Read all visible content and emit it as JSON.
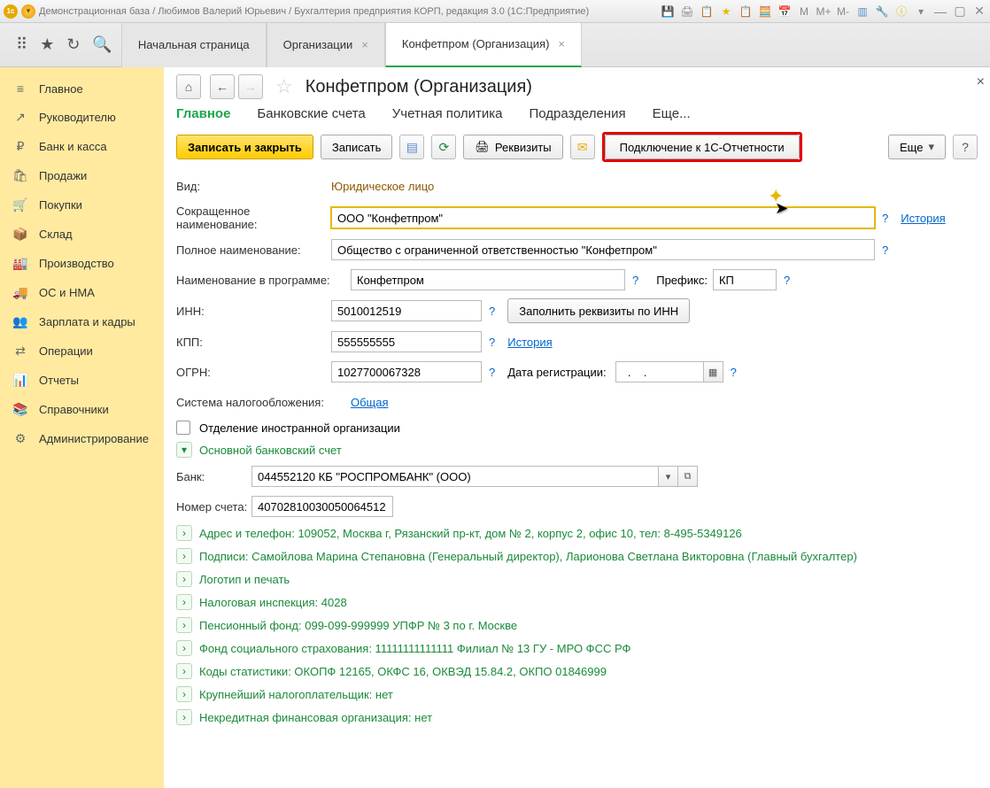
{
  "title": "Демонстрационная база / Любимов Валерий Юрьевич / Бухгалтерия предприятия КОРП, редакция 3.0 (1С:Предприятие)",
  "tabs": {
    "t0": "Начальная страница",
    "t1": "Организации",
    "t2": "Конфетпром (Организация)"
  },
  "sidebar": {
    "items": [
      {
        "icon": "≡",
        "label": "Главное"
      },
      {
        "icon": "↗",
        "label": "Руководителю"
      },
      {
        "icon": "₽",
        "label": "Банк и касса"
      },
      {
        "icon": "🛍",
        "label": "Продажи"
      },
      {
        "icon": "🛒",
        "label": "Покупки"
      },
      {
        "icon": "📦",
        "label": "Склад"
      },
      {
        "icon": "🏭",
        "label": "Производство"
      },
      {
        "icon": "🚚",
        "label": "ОС и НМА"
      },
      {
        "icon": "👥",
        "label": "Зарплата и кадры"
      },
      {
        "icon": "⇄",
        "label": "Операции"
      },
      {
        "icon": "📊",
        "label": "Отчеты"
      },
      {
        "icon": "📚",
        "label": "Справочники"
      },
      {
        "icon": "⚙",
        "label": "Администрирование"
      }
    ]
  },
  "page": {
    "title": "Конфетпром (Организация)",
    "subtabs": {
      "main": "Главное",
      "bank": "Банковские счета",
      "policy": "Учетная политика",
      "divisions": "Подразделения",
      "more": "Еще..."
    }
  },
  "toolbar": {
    "save_close": "Записать и закрыть",
    "save": "Записать",
    "requisites": "Реквизиты",
    "connect_1c": "Подключение к 1С-Отчетности",
    "more": "Еще",
    "help": "?"
  },
  "labels": {
    "vid": "Вид:",
    "short_name": "Сокращенное наименование:",
    "full_name": "Полное наименование:",
    "prog_name": "Наименование в программе:",
    "prefix": "Префикс:",
    "inn": "ИНН:",
    "fill_inn": "Заполнить реквизиты по ИНН",
    "kpp": "КПП:",
    "history": "История",
    "history2": "История",
    "ogrn": "ОГРН:",
    "reg_date": "Дата регистрации:",
    "tax": "Система налогообложения:",
    "tax_link": "Общая",
    "foreign": "Отделение иностранной организации",
    "bank_group": "Основной банковский счет",
    "bank": "Банк:",
    "account": "Номер счета:"
  },
  "values": {
    "vid": "Юридическое лицо",
    "short_name": "ООО \"Конфетпром\"",
    "full_name": "Общество с ограниченной ответственностью \"Конфетпром\"",
    "prog_name": "Конфетпром",
    "prefix": "КП",
    "inn": "5010012519",
    "kpp": "555555555",
    "ogrn": "1027700067328",
    "reg_date": "  .    .    ",
    "bank": "044552120 КБ \"РОСПРОМБАНК\" (ООО)",
    "account": "40702810030050064512"
  },
  "groups": {
    "g1": "Адрес и телефон: 109052, Москва г, Рязанский пр-кт, дом № 2, корпус 2, офис 10, тел: 8-495-5349126",
    "g2": "Подписи: Самойлова Марина Степановна (Генеральный директор), Ларионова Светлана Викторовна (Главный бухгалтер)",
    "g3": "Логотип и печать",
    "g4": "Налоговая инспекция: 4028",
    "g5": "Пенсионный фонд: 099-099-999999 УПФР № 3 по г. Москве",
    "g6": "Фонд социального страхования: 11111111111111 Филиал № 13 ГУ - МРО ФСС РФ",
    "g7": "Коды статистики: ОКОПФ 12165, ОКФС 16, ОКВЭД 15.84.2, ОКПО 01846999",
    "g8": "Крупнейший налогоплательщик: нет",
    "g9": "Некредитная финансовая организация: нет"
  }
}
